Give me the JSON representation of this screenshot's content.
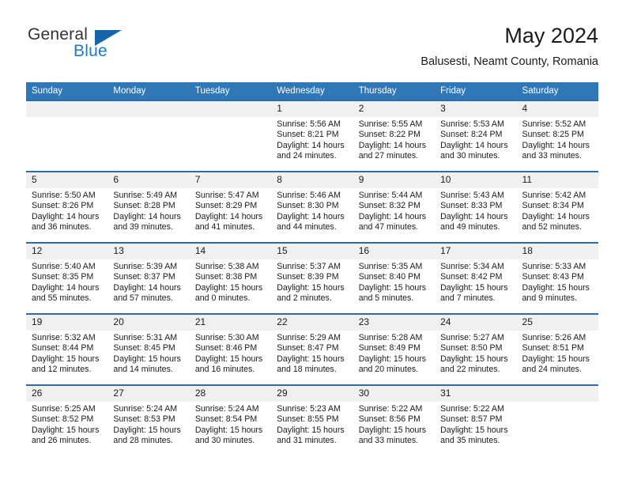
{
  "logo": {
    "word_top": "General",
    "word_bottom": "Blue",
    "triangle_color": "#1565a8",
    "blue_text_color": "#1d7cc4"
  },
  "header": {
    "title": "May 2024",
    "subtitle": "Balusesti, Neamt County, Romania"
  },
  "theme": {
    "header_blue": "#3077b7",
    "row_border_blue": "#2e6da4",
    "daynum_band": "#f0f0f0"
  },
  "weekdays": [
    "Sunday",
    "Monday",
    "Tuesday",
    "Wednesday",
    "Thursday",
    "Friday",
    "Saturday"
  ],
  "weeks": [
    [
      {
        "day": "",
        "lines": []
      },
      {
        "day": "",
        "lines": []
      },
      {
        "day": "",
        "lines": []
      },
      {
        "day": "1",
        "lines": [
          "Sunrise: 5:56 AM",
          "Sunset: 8:21 PM",
          "Daylight: 14 hours",
          "and 24 minutes."
        ]
      },
      {
        "day": "2",
        "lines": [
          "Sunrise: 5:55 AM",
          "Sunset: 8:22 PM",
          "Daylight: 14 hours",
          "and 27 minutes."
        ]
      },
      {
        "day": "3",
        "lines": [
          "Sunrise: 5:53 AM",
          "Sunset: 8:24 PM",
          "Daylight: 14 hours",
          "and 30 minutes."
        ]
      },
      {
        "day": "4",
        "lines": [
          "Sunrise: 5:52 AM",
          "Sunset: 8:25 PM",
          "Daylight: 14 hours",
          "and 33 minutes."
        ]
      }
    ],
    [
      {
        "day": "5",
        "lines": [
          "Sunrise: 5:50 AM",
          "Sunset: 8:26 PM",
          "Daylight: 14 hours",
          "and 36 minutes."
        ]
      },
      {
        "day": "6",
        "lines": [
          "Sunrise: 5:49 AM",
          "Sunset: 8:28 PM",
          "Daylight: 14 hours",
          "and 39 minutes."
        ]
      },
      {
        "day": "7",
        "lines": [
          "Sunrise: 5:47 AM",
          "Sunset: 8:29 PM",
          "Daylight: 14 hours",
          "and 41 minutes."
        ]
      },
      {
        "day": "8",
        "lines": [
          "Sunrise: 5:46 AM",
          "Sunset: 8:30 PM",
          "Daylight: 14 hours",
          "and 44 minutes."
        ]
      },
      {
        "day": "9",
        "lines": [
          "Sunrise: 5:44 AM",
          "Sunset: 8:32 PM",
          "Daylight: 14 hours",
          "and 47 minutes."
        ]
      },
      {
        "day": "10",
        "lines": [
          "Sunrise: 5:43 AM",
          "Sunset: 8:33 PM",
          "Daylight: 14 hours",
          "and 49 minutes."
        ]
      },
      {
        "day": "11",
        "lines": [
          "Sunrise: 5:42 AM",
          "Sunset: 8:34 PM",
          "Daylight: 14 hours",
          "and 52 minutes."
        ]
      }
    ],
    [
      {
        "day": "12",
        "lines": [
          "Sunrise: 5:40 AM",
          "Sunset: 8:35 PM",
          "Daylight: 14 hours",
          "and 55 minutes."
        ]
      },
      {
        "day": "13",
        "lines": [
          "Sunrise: 5:39 AM",
          "Sunset: 8:37 PM",
          "Daylight: 14 hours",
          "and 57 minutes."
        ]
      },
      {
        "day": "14",
        "lines": [
          "Sunrise: 5:38 AM",
          "Sunset: 8:38 PM",
          "Daylight: 15 hours",
          "and 0 minutes."
        ]
      },
      {
        "day": "15",
        "lines": [
          "Sunrise: 5:37 AM",
          "Sunset: 8:39 PM",
          "Daylight: 15 hours",
          "and 2 minutes."
        ]
      },
      {
        "day": "16",
        "lines": [
          "Sunrise: 5:35 AM",
          "Sunset: 8:40 PM",
          "Daylight: 15 hours",
          "and 5 minutes."
        ]
      },
      {
        "day": "17",
        "lines": [
          "Sunrise: 5:34 AM",
          "Sunset: 8:42 PM",
          "Daylight: 15 hours",
          "and 7 minutes."
        ]
      },
      {
        "day": "18",
        "lines": [
          "Sunrise: 5:33 AM",
          "Sunset: 8:43 PM",
          "Daylight: 15 hours",
          "and 9 minutes."
        ]
      }
    ],
    [
      {
        "day": "19",
        "lines": [
          "Sunrise: 5:32 AM",
          "Sunset: 8:44 PM",
          "Daylight: 15 hours",
          "and 12 minutes."
        ]
      },
      {
        "day": "20",
        "lines": [
          "Sunrise: 5:31 AM",
          "Sunset: 8:45 PM",
          "Daylight: 15 hours",
          "and 14 minutes."
        ]
      },
      {
        "day": "21",
        "lines": [
          "Sunrise: 5:30 AM",
          "Sunset: 8:46 PM",
          "Daylight: 15 hours",
          "and 16 minutes."
        ]
      },
      {
        "day": "22",
        "lines": [
          "Sunrise: 5:29 AM",
          "Sunset: 8:47 PM",
          "Daylight: 15 hours",
          "and 18 minutes."
        ]
      },
      {
        "day": "23",
        "lines": [
          "Sunrise: 5:28 AM",
          "Sunset: 8:49 PM",
          "Daylight: 15 hours",
          "and 20 minutes."
        ]
      },
      {
        "day": "24",
        "lines": [
          "Sunrise: 5:27 AM",
          "Sunset: 8:50 PM",
          "Daylight: 15 hours",
          "and 22 minutes."
        ]
      },
      {
        "day": "25",
        "lines": [
          "Sunrise: 5:26 AM",
          "Sunset: 8:51 PM",
          "Daylight: 15 hours",
          "and 24 minutes."
        ]
      }
    ],
    [
      {
        "day": "26",
        "lines": [
          "Sunrise: 5:25 AM",
          "Sunset: 8:52 PM",
          "Daylight: 15 hours",
          "and 26 minutes."
        ]
      },
      {
        "day": "27",
        "lines": [
          "Sunrise: 5:24 AM",
          "Sunset: 8:53 PM",
          "Daylight: 15 hours",
          "and 28 minutes."
        ]
      },
      {
        "day": "28",
        "lines": [
          "Sunrise: 5:24 AM",
          "Sunset: 8:54 PM",
          "Daylight: 15 hours",
          "and 30 minutes."
        ]
      },
      {
        "day": "29",
        "lines": [
          "Sunrise: 5:23 AM",
          "Sunset: 8:55 PM",
          "Daylight: 15 hours",
          "and 31 minutes."
        ]
      },
      {
        "day": "30",
        "lines": [
          "Sunrise: 5:22 AM",
          "Sunset: 8:56 PM",
          "Daylight: 15 hours",
          "and 33 minutes."
        ]
      },
      {
        "day": "31",
        "lines": [
          "Sunrise: 5:22 AM",
          "Sunset: 8:57 PM",
          "Daylight: 15 hours",
          "and 35 minutes."
        ]
      },
      {
        "day": "",
        "lines": []
      }
    ]
  ]
}
